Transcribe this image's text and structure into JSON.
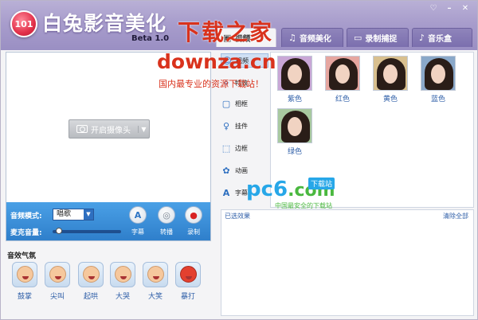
{
  "app": {
    "logo_text": "101",
    "title": "白兔影音美化",
    "version": "Beta 1.0",
    "window_controls": [
      "♡",
      "–",
      "✕"
    ]
  },
  "tabs": [
    {
      "label": "视频",
      "icon": "camera-icon",
      "active": true
    },
    {
      "label": "音频美化",
      "icon": "headphones-icon",
      "active": false
    },
    {
      "label": "录制捕捉",
      "icon": "record-icon",
      "active": false
    },
    {
      "label": "音乐盒",
      "icon": "music-note-icon",
      "active": false
    }
  ],
  "watermark": {
    "top": "下载之家",
    "url": "downza.cn",
    "slogan": "国内最专业的资源下载站！"
  },
  "video": {
    "camera_button": "开启摄像头"
  },
  "controls": {
    "audio_mode_label": "音频模式:",
    "audio_mode_value": "唱歌",
    "mic_volume_label": "麦克音量:",
    "mic_volume_level": 0.05,
    "buttons": [
      {
        "label": "字幕",
        "icon": "subtitle-a-icon",
        "glyph": "A"
      },
      {
        "label": "转播",
        "icon": "relay-icon",
        "glyph": "◎"
      },
      {
        "label": "录制",
        "icon": "record-dot-icon",
        "glyph": "●"
      }
    ]
  },
  "effects": {
    "title": "音效气氛",
    "items": [
      "鼓掌",
      "尖叫",
      "起哄",
      "大哭",
      "大笑",
      "暴打"
    ]
  },
  "sub_nav": [
    {
      "label": "视频",
      "icon": "face-icon"
    },
    {
      "label": "特效",
      "icon": "sparkle-icon"
    },
    {
      "label": "相框",
      "icon": "frame-icon"
    },
    {
      "label": "挂件",
      "icon": "pendant-icon"
    },
    {
      "label": "边框",
      "icon": "border-icon"
    },
    {
      "label": "动画",
      "icon": "film-reel-icon"
    },
    {
      "label": "字幕",
      "icon": "text-a-icon"
    }
  ],
  "filters": [
    {
      "label": "紫色",
      "tint": "#c9a7d6"
    },
    {
      "label": "红色",
      "tint": "#e6a6a0"
    },
    {
      "label": "黄色",
      "tint": "#d9c08f"
    },
    {
      "label": "蓝色",
      "tint": "#8aa8c9"
    },
    {
      "label": "绿色",
      "tint": "#a8c9a0"
    }
  ],
  "selected": {
    "title": "已选效果",
    "clear_all": "清除全部"
  },
  "pc6": {
    "brand": "pc6",
    "domain": ".com",
    "badge": "下载站",
    "slogan": "中国最安全的下载站"
  }
}
